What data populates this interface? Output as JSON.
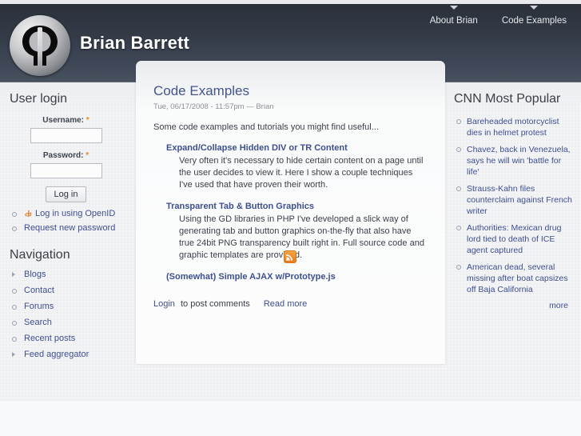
{
  "site": {
    "title": "Brian Barrett",
    "logo_icon": "qp-monogram-logo"
  },
  "topnav": [
    {
      "label": "About Brian"
    },
    {
      "label": "Code Examples"
    }
  ],
  "sidebar_left": {
    "login_block": {
      "title": "User login",
      "username_label": "Username:",
      "username_value": "",
      "password_label": "Password:",
      "password_value": "",
      "required_mark": "*",
      "submit_label": "Log in",
      "links": [
        {
          "label": "Log in using OpenID",
          "icon": "openid-icon",
          "bullet": "circle"
        },
        {
          "label": "Request new password",
          "bullet": "circle"
        }
      ]
    },
    "nav_block": {
      "title": "Navigation",
      "items": [
        {
          "label": "Blogs",
          "bullet": "triangle"
        },
        {
          "label": "Contact",
          "bullet": "circle"
        },
        {
          "label": "Forums",
          "bullet": "circle"
        },
        {
          "label": "Search",
          "bullet": "circle"
        },
        {
          "label": "Recent posts",
          "bullet": "circle"
        },
        {
          "label": "Feed aggregator",
          "bullet": "triangle"
        }
      ]
    }
  },
  "content": {
    "title": "Code Examples",
    "submitted": "Tue, 06/17/2008 - 11:57pm — Brian",
    "intro": "Some code examples and tutorials you might find useful...",
    "entries": [
      {
        "term": "Expand/Collapse Hidden DIV or TR Content",
        "definition": "Very often it's necessary to hide certain content on a page until the user decides to view it. Here I show a couple techniques I've used that have proven their worth."
      },
      {
        "term": "Transparent Tab & Button Graphics",
        "definition": "Using the GD libraries in PHP I've developed a slick way of generating tab and button graphics on-the-fly that also have true 24bit PNG transparency built right in. Full source code and graphic templates are provided."
      },
      {
        "term": "(Somewhat) Simple AJAX w/Prototype.js",
        "definition": ""
      }
    ],
    "login_link": "Login",
    "login_suffix": " to post comments",
    "read_more": "Read more",
    "feed_icon": "rss-feed-icon"
  },
  "sidebar_right": {
    "title": "CNN Most Popular",
    "items": [
      {
        "label": "Bareheaded motorcyclist dies in helmet protest"
      },
      {
        "label": "Chavez, back in Venezuela, says he will win 'battle for life'"
      },
      {
        "label": "Strauss-Kahn files counterclaim against French writer"
      },
      {
        "label": "Authorities: Mexican drug lord tied to death of ICE agent captured"
      },
      {
        "label": "American dead, several missing after boat capsizes off Baja California"
      }
    ],
    "more_label": "more"
  },
  "colors": {
    "header_dark": "#2b303a",
    "header_light": "#48525f",
    "link": "#3d4f8f",
    "accent_orange": "#e08b1c",
    "body_bg": "#f1f2f4"
  }
}
